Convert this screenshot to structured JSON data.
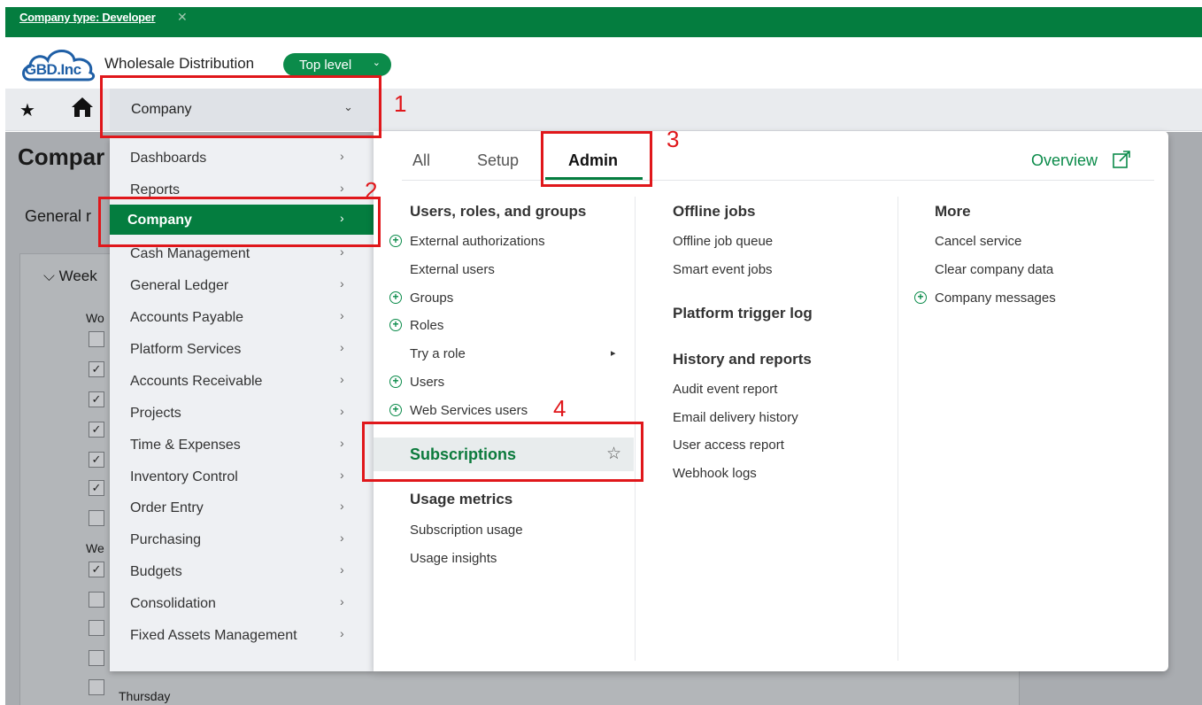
{
  "topbar": {
    "filter_label": "Company type: Developer",
    "close_glyph": "✕"
  },
  "brand": {
    "logo_text": "GBD.Inc",
    "company_name": "Wholesale Distribution",
    "level_label": "Top level"
  },
  "nav": {
    "star_icon": "★",
    "company_label": "Company",
    "chevron": "⌄"
  },
  "background": {
    "title": "Compar",
    "general": "General r",
    "week": "⌵ Week",
    "wo": "Wo",
    "we": "We",
    "thursday": "Thursday",
    "check_glyph": "✓"
  },
  "left_menu": {
    "items": [
      {
        "label": "Dashboards"
      },
      {
        "label": "Reports"
      },
      {
        "label": "Company"
      },
      {
        "label": "Cash Management"
      },
      {
        "label": "General Ledger"
      },
      {
        "label": "Accounts Payable"
      },
      {
        "label": "Platform Services"
      },
      {
        "label": "Accounts Receivable"
      },
      {
        "label": "Projects"
      },
      {
        "label": "Time & Expenses"
      },
      {
        "label": "Inventory Control"
      },
      {
        "label": "Order Entry"
      },
      {
        "label": "Purchasing"
      },
      {
        "label": "Budgets"
      },
      {
        "label": "Consolidation"
      },
      {
        "label": "Fixed Assets Management"
      }
    ],
    "chevron": "›"
  },
  "panel": {
    "tabs": {
      "all": "All",
      "setup": "Setup",
      "admin": "Admin"
    },
    "overview": "Overview",
    "col1": {
      "heading": "Users, roles, and groups",
      "links": {
        "external_authorizations": "External authorizations",
        "external_users": "External users",
        "groups": "Groups",
        "roles": "Roles",
        "try_a_role": "Try a role",
        "users": "Users",
        "web_services_users": "Web Services users"
      },
      "subscriptions": "Subscriptions",
      "star_icon": "☆",
      "usage_heading": "Usage metrics",
      "subscription_usage": "Subscription usage",
      "usage_insights": "Usage insights"
    },
    "col2": {
      "offline_heading": "Offline jobs",
      "offline_job_queue": "Offline job queue",
      "smart_event_jobs": "Smart event jobs",
      "platform_trigger_log": "Platform trigger log",
      "history_heading": "History and reports",
      "audit_event_report": "Audit event report",
      "email_delivery_history": "Email delivery history",
      "user_access_report": "User access report",
      "webhook_logs": "Webhook logs"
    },
    "col3": {
      "more_heading": "More",
      "cancel_service": "Cancel service",
      "clear_company_data": "Clear company data",
      "company_messages": "Company messages"
    },
    "plus_glyph": "+",
    "arrow_glyph": "▸"
  },
  "annotations": {
    "n1": "1",
    "n2": "2",
    "n3": "3",
    "n4": "4"
  }
}
